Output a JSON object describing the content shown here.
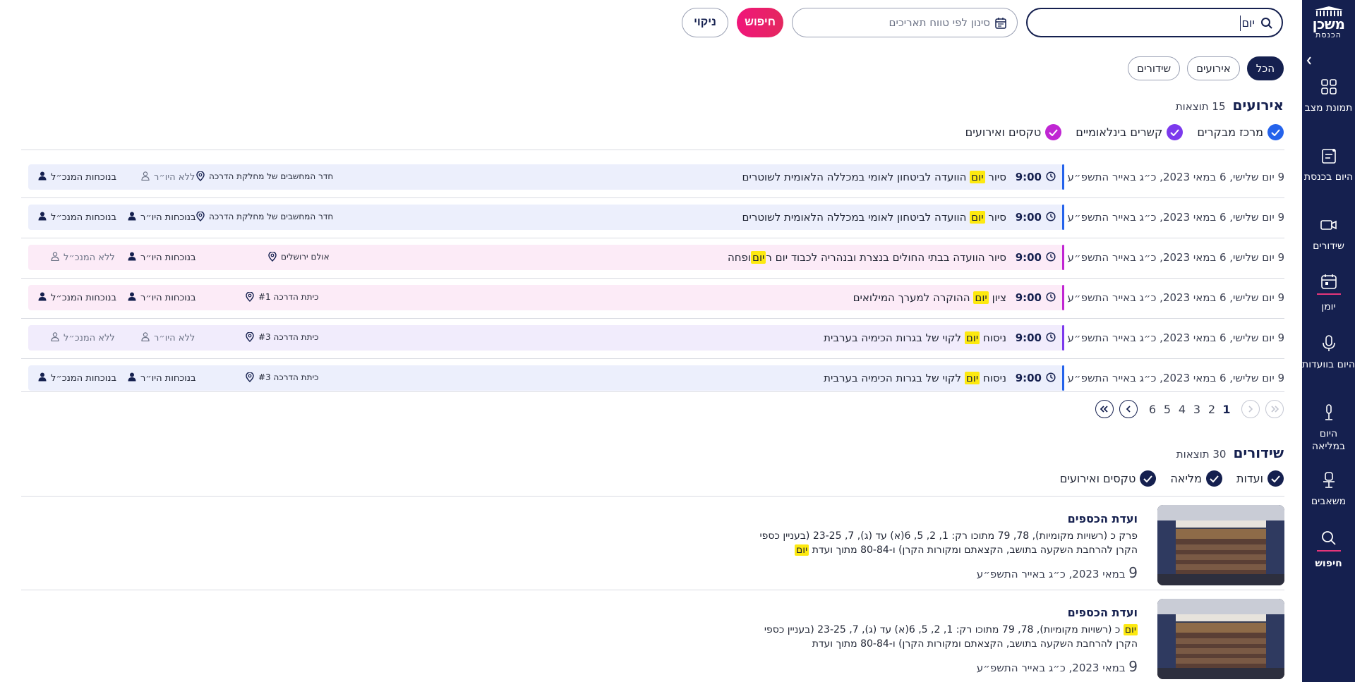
{
  "sidebar": {
    "logo": {
      "line1": "משכן",
      "line2": "הכנסת"
    },
    "items": [
      {
        "label": "תמונת מצב",
        "icon": "grid-icon"
      },
      {
        "label": "היום בכנסת",
        "icon": "document-icon"
      },
      {
        "label": "שידורים",
        "icon": "video-camera-icon"
      },
      {
        "label": "יומן",
        "icon": "calendar-icon"
      },
      {
        "label": "היום בוועדות",
        "icon": "microphone-icon"
      },
      {
        "label": "היום במליאה",
        "icon": "microphone-stand-icon"
      },
      {
        "label": "משאבים",
        "icon": "chair-icon"
      },
      {
        "label": "חיפוש",
        "icon": "search-icon"
      }
    ]
  },
  "search": {
    "value": "יום",
    "date_placeholder": "סינון לפי טווח תאריכים",
    "search_label": "חיפוש",
    "clear_label": "ניקוי"
  },
  "tabs": [
    {
      "label": "הכל",
      "active": true
    },
    {
      "label": "אירועים",
      "active": false
    },
    {
      "label": "שידורים",
      "active": false
    }
  ],
  "events": {
    "title": "אירועים",
    "count_label": "15 תוצאות",
    "categories": [
      {
        "label": "מרכז מבקרים",
        "color": "#2563eb"
      },
      {
        "label": "קשרים בינלאומיים",
        "color": "#7c3aed"
      },
      {
        "label": "טקסים ואירועים",
        "color": "#c026d3"
      }
    ],
    "rows": [
      {
        "date": "9 יום שלישי, 6 במאי 2023, כ״ג באייר התשפ״ע",
        "time": "9:00",
        "pre": "סיור ",
        "hl": "יום",
        "post": " הוועדה לביטחון לאומי במכללה הלאומית לשוטרים",
        "location": "חדר המחשבים של מחלקת הדרכה",
        "chair": "ללא היו״ר",
        "chair_present": false,
        "dg": "בנוכחות המנכ״ל",
        "dg_present": true,
        "bg": "#eceffc",
        "stripe": "#2563eb"
      },
      {
        "date": "9 יום שלישי, 6 במאי 2023, כ״ג באייר התשפ״ע",
        "time": "9:00",
        "pre": "סיור ",
        "hl": "יום",
        "post": " הוועדה לביטחון לאומי במכללה הלאומית לשוטרים",
        "location": "חדר המחשבים של מחלקת הדרכה",
        "chair": "בנוכחות היו״ר",
        "chair_present": true,
        "dg": "בנוכחות המנכ״ל",
        "dg_present": true,
        "bg": "#eceffc",
        "stripe": "#2563eb"
      },
      {
        "date": "9 יום שלישי, 6 במאי 2023, כ״ג באייר התשפ״ע",
        "time": "9:00",
        "pre": "סיור הוועדה בבתי החולים בנצרת ובנהריה לכבוד יום ר",
        "hl": "יום",
        "post": "ופחה",
        "location": "אולם ירושלים",
        "chair": "בנוכחות היו״ר",
        "chair_present": true,
        "dg": "ללא המנכ״ל",
        "dg_present": false,
        "bg": "#fcebf7",
        "stripe": "#c026d3"
      },
      {
        "date": "9 יום שלישי, 6 במאי 2023, כ״ג באייר התשפ״ע",
        "time": "9:00",
        "pre": "ציון ",
        "hl": "יום",
        "post": " ההוקרה למערך המילואים",
        "location": "כיתת הדרכה #1",
        "chair": "בנוכחות היו״ר",
        "chair_present": true,
        "dg": "בנוכחות המנכ״ל",
        "dg_present": true,
        "bg": "#fcebf7",
        "stripe": "#c026d3"
      },
      {
        "date": "9 יום שלישי, 6 במאי 2023, כ״ג באייר התשפ״ע",
        "time": "9:00",
        "pre": "ניסוח ",
        "hl": "יום",
        "post": " לקוי של בגרות הכימיה בערבית",
        "location": "כיתת הדרכה #3",
        "chair": "ללא היו״ר",
        "chair_present": false,
        "dg": "ללא המנכ״ל",
        "dg_present": false,
        "bg": "#f1ecfc",
        "stripe": "#7c3aed"
      },
      {
        "date": "9 יום שלישי, 6 במאי 2023, כ״ג באייר התשפ״ע",
        "time": "9:00",
        "pre": "ניסוח ",
        "hl": "יום",
        "post": " לקוי של בגרות הכימיה בערבית",
        "location": "כיתת הדרכה #3",
        "chair": "בנוכחות היו״ר",
        "chair_present": true,
        "dg": "בנוכחות המנכ״ל",
        "dg_present": true,
        "bg": "#eceffc",
        "stripe": "#2563eb"
      }
    ]
  },
  "pagination": {
    "pages": [
      "1",
      "2",
      "3",
      "4",
      "5",
      "6"
    ],
    "current": "1"
  },
  "broadcasts": {
    "title": "שידורים",
    "count_label": "30 תוצאות",
    "categories": [
      {
        "label": "ועדות"
      },
      {
        "label": "מליאה"
      },
      {
        "label": "טקסים ואירועים"
      }
    ],
    "items": [
      {
        "title": "ועדת הכספים",
        "pre": "פרק כ (רשויות מקומיות), 78, 79 מתוכו רק: 1, 2, 5, 6(א) עד (ג), 7, 23-25 (בעניין כספי הקרן להרחבת השקעה בתושב, הקצאתם ומקורות הקרן) ו-80-84 מתוך ועדת ",
        "hl": "יום",
        "post": "",
        "day": "9",
        "date": " במאי 2023, כ״ג באייר התשפ״ע"
      },
      {
        "title": "ועדת הכספים",
        "pre": "",
        "hl": "יום",
        "post": " כ (רשויות מקומיות), 78, 79 מתוכו רק: 1, 2, 5, 6(א) עד (ג), 7, 23-25 (בעניין כספי הקרן להרחבת השקעה בתושב, הקצאתם ומקורות הקרן) ו-80-84 מתוך ועדת",
        "day": "9",
        "date": " במאי 2023, כ״ג באייר התשפ״ע"
      }
    ]
  }
}
